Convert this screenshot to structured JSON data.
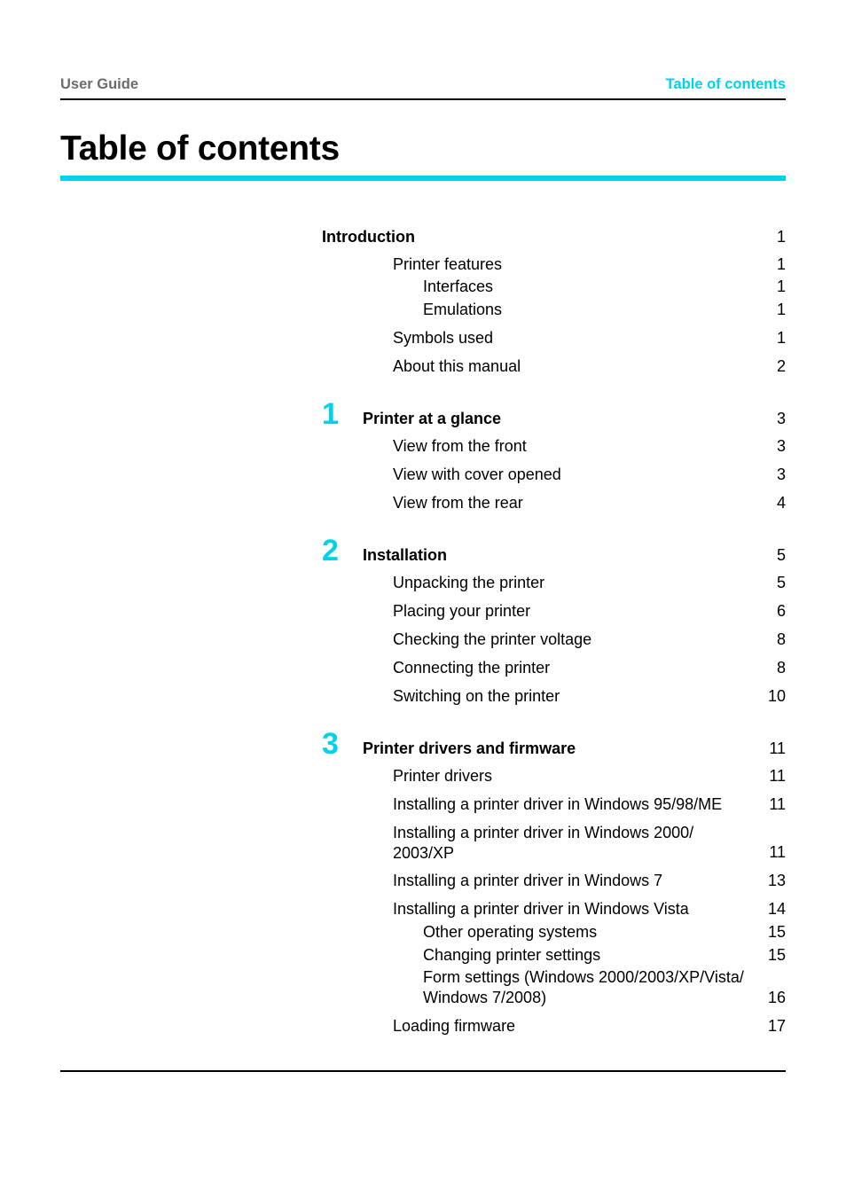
{
  "header": {
    "left": "User Guide",
    "right": "Table of contents"
  },
  "page_title": "Table of contents",
  "colors": {
    "accent": "#00d2ec",
    "header_gray": "#6b6b6b"
  },
  "chapters": [
    {
      "number": "1"
    },
    {
      "number": "2"
    },
    {
      "number": "3"
    }
  ],
  "toc": [
    {
      "text": "Introduction",
      "page": "1"
    },
    {
      "text": "Printer features",
      "page": "1"
    },
    {
      "text": "Interfaces",
      "page": "1"
    },
    {
      "text": "Emulations",
      "page": "1"
    },
    {
      "text": "Symbols used",
      "page": "1"
    },
    {
      "text": "About this manual",
      "page": "2"
    },
    {
      "text": "Printer at a glance",
      "page": "3"
    },
    {
      "text": "View from the front",
      "page": "3"
    },
    {
      "text": "View with cover opened",
      "page": "3"
    },
    {
      "text": "View from the rear",
      "page": "4"
    },
    {
      "text": "Installation",
      "page": "5"
    },
    {
      "text": "Unpacking the printer",
      "page": "5"
    },
    {
      "text": "Placing your printer",
      "page": "6"
    },
    {
      "text": "Checking the printer voltage",
      "page": "8"
    },
    {
      "text": "Connecting the printer",
      "page": "8"
    },
    {
      "text": "Switching on the printer",
      "page": "10"
    },
    {
      "text": "Printer drivers and firmware",
      "page": "11"
    },
    {
      "text": "Printer drivers",
      "page": "11"
    },
    {
      "text": "Installing a printer driver in Windows 95/98/ME",
      "page": "11"
    },
    {
      "text": "Installing a printer driver in Windows 2000/\n2003/XP",
      "page": "11"
    },
    {
      "text": "Installing a printer driver in Windows 7",
      "page": "13"
    },
    {
      "text": "Installing a printer driver in Windows Vista",
      "page": "14"
    },
    {
      "text": "Other operating systems",
      "page": "15"
    },
    {
      "text": "Changing printer settings",
      "page": "15"
    },
    {
      "text": "Form settings (Windows 2000/2003/XP/Vista/\nWindows 7/2008)",
      "page": "16"
    },
    {
      "text": "Loading firmware",
      "page": "17"
    }
  ]
}
